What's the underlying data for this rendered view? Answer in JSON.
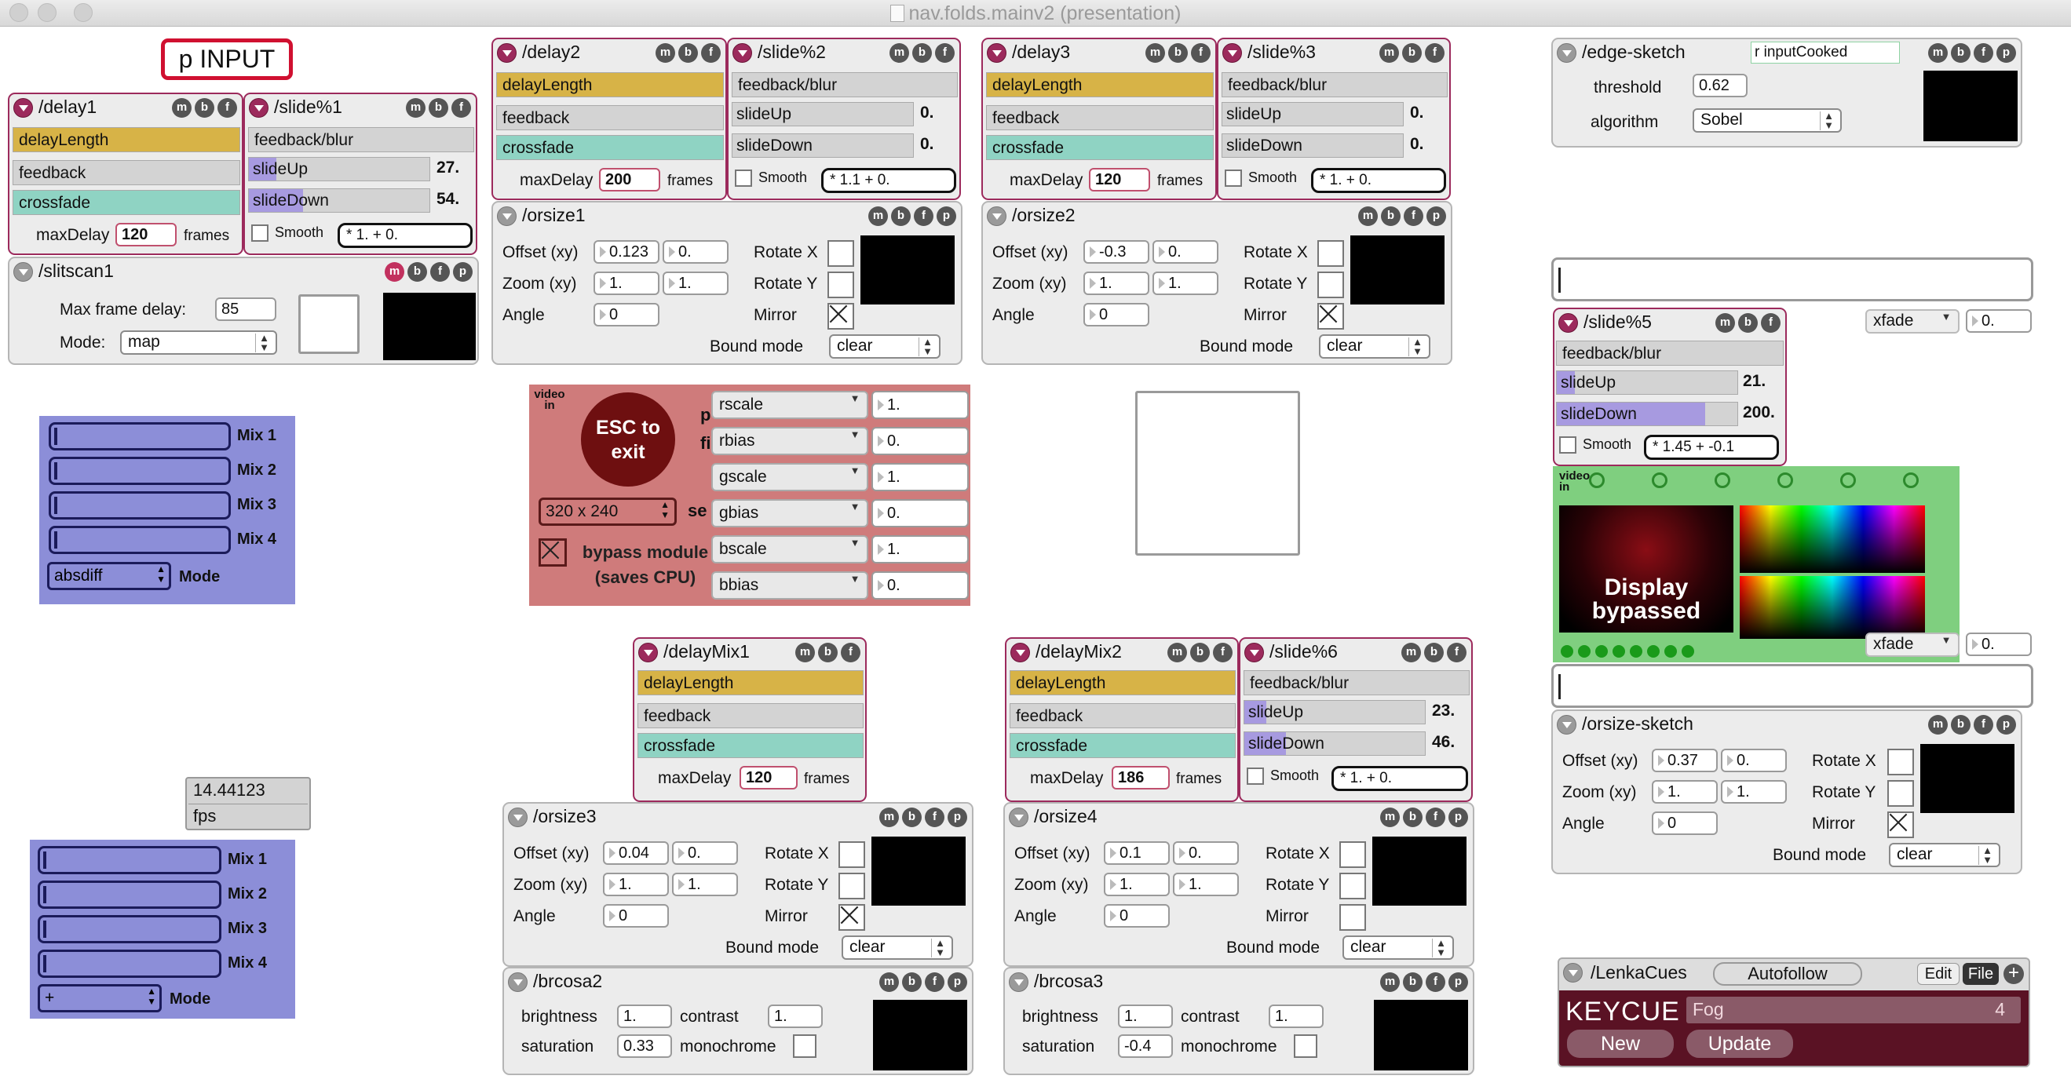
{
  "window": {
    "title": "nav.folds.mainv2 (presentation)"
  },
  "input_label": "p INPUT",
  "ctrl": {
    "m": "m",
    "b": "b",
    "f": "f",
    "p": "p"
  },
  "common": {
    "delayLength": "delayLength",
    "feedback": "feedback",
    "crossfade": "crossfade",
    "maxDelay": "maxDelay",
    "frames": "frames",
    "feedback_blur": "feedback/blur",
    "slideUp": "slideUp",
    "slideDown": "slideDown",
    "smooth": "Smooth",
    "offset": "Offset (xy)",
    "zoom": "Zoom (xy)",
    "angle": "Angle",
    "rotx": "Rotate X",
    "roty": "Rotate Y",
    "mirror": "Mirror",
    "bound": "Bound mode",
    "brightness": "brightness",
    "contrast": "contrast",
    "saturation": "saturation",
    "monochrome": "monochrome",
    "xfade": "xfade"
  },
  "delay1": {
    "title": "/delay1",
    "maxDelay": "120"
  },
  "slide1": {
    "title": "/slide%1",
    "up": "27.",
    "down": "54.",
    "up_level": 0.15,
    "down_level": 0.3,
    "smooth": "* 1.      + 0."
  },
  "delay2": {
    "title": "/delay2",
    "maxDelay": "200"
  },
  "slide2": {
    "title": "/slide%2",
    "up": "0.",
    "down": "0.",
    "up_level": 0,
    "down_level": 0,
    "smooth": "* 1.1     + 0."
  },
  "delay3": {
    "title": "/delay3",
    "maxDelay": "120"
  },
  "slide3": {
    "title": "/slide%3",
    "up": "0.",
    "down": "0.",
    "up_level": 0,
    "down_level": 0,
    "smooth": "* 1.      + 0."
  },
  "slitscan": {
    "title": "/slitscan1",
    "max_label": "Max frame delay:",
    "max": "85",
    "mode_label": "Mode:",
    "mode": "map"
  },
  "orsize1": {
    "title": "/orsize1",
    "ox": "0.123",
    "oy": "0.",
    "zx": "1.",
    "zy": "1.",
    "angle": "0",
    "bound": "clear",
    "mirror_checked": true
  },
  "orsize2": {
    "title": "/orsize2",
    "ox": "-0.3",
    "oy": "0.",
    "zx": "1.",
    "zy": "1.",
    "angle": "0",
    "bound": "clear",
    "mirror_checked": true
  },
  "edge": {
    "title": "/edge-sketch",
    "tag": "r inputCooked",
    "threshold_label": "threshold",
    "threshold": "0.62",
    "algorithm_label": "algorithm",
    "algorithm": "Sobel"
  },
  "slide5": {
    "title": "/slide%5",
    "up": "21.",
    "down": "200.",
    "up_level": 0.1,
    "down_level": 0.82,
    "smooth": "* 1.45  + -0.1"
  },
  "mixA": {
    "labels": [
      "Mix 1",
      "Mix 2",
      "Mix 3",
      "Mix 4"
    ],
    "mode": "absdiff",
    "mode_label": "Mode"
  },
  "mixB": {
    "labels": [
      "Mix 1",
      "Mix 2",
      "Mix 3",
      "Mix 4"
    ],
    "mode": "+",
    "mode_label": "Mode"
  },
  "videoIn": {
    "tag": "video in",
    "esc": "ESC to exit",
    "res": "320 x 240",
    "bypass": "bypass module (saves CPU)",
    "obscured_p": "p",
    "obscured_fi": "fi",
    "obscured_se": "se"
  },
  "scales": [
    {
      "name": "rscale",
      "val": "1."
    },
    {
      "name": "rbias",
      "val": "0."
    },
    {
      "name": "gscale",
      "val": "1."
    },
    {
      "name": "gbias",
      "val": "0."
    },
    {
      "name": "bscale",
      "val": "1."
    },
    {
      "name": "bbias",
      "val": "0."
    }
  ],
  "xfadeA": {
    "val": "0."
  },
  "xfadeB": {
    "val": "0."
  },
  "videoIn2": {
    "tag": "video in",
    "display": "Display bypassed"
  },
  "fps": {
    "value": "14.44123",
    "label": "fps"
  },
  "delayMix1": {
    "title": "/delayMix1",
    "maxDelay": "120"
  },
  "delayMix2": {
    "title": "/delayMix2",
    "maxDelay": "186"
  },
  "slide6": {
    "title": "/slide%6",
    "up": "23.",
    "down": "46.",
    "up_level": 0.12,
    "down_level": 0.23,
    "smooth": "* 1.      + 0."
  },
  "orsize3": {
    "title": "/orsize3",
    "ox": "0.04",
    "oy": "0.",
    "zx": "1.",
    "zy": "1.",
    "angle": "0",
    "bound": "clear",
    "mirror_checked": true
  },
  "orsize4": {
    "title": "/orsize4",
    "ox": "0.1",
    "oy": "0.",
    "zx": "1.",
    "zy": "1.",
    "angle": "0",
    "bound": "clear",
    "mirror_checked": false
  },
  "orsizeS": {
    "title": "/orsize-sketch",
    "ox": "0.37",
    "oy": "0.",
    "zx": "1.",
    "zy": "1.",
    "angle": "0",
    "bound": "clear",
    "mirror_checked": true
  },
  "brcosa2": {
    "title": "/brcosa2",
    "brightness": "1.",
    "contrast": "1.",
    "saturation": "0.33"
  },
  "brcosa3": {
    "title": "/brcosa3",
    "brightness": "1.",
    "contrast": "1.",
    "saturation": "-0.4"
  },
  "cues": {
    "title": "/LenkaCues",
    "autofollow": "Autofollow",
    "edit": "Edit",
    "file": "File",
    "add": "+",
    "keycue": "KEYCUE",
    "cue": "Fog",
    "cue_num": "4",
    "new": "New",
    "update": "Update"
  }
}
